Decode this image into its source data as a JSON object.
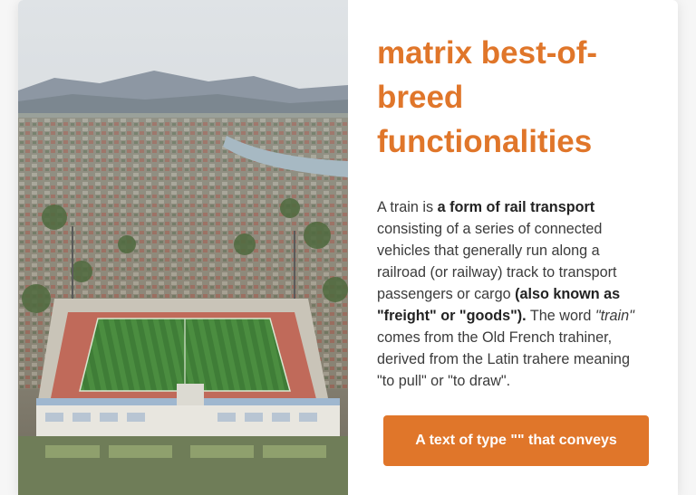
{
  "hero": {
    "image_alt": "aerial view of a stadium in a city"
  },
  "headline": "matrix best-of-breed functionalities",
  "body": {
    "part1": "A train is ",
    "bold1": "a form of rail transport",
    "part2": " consisting of a series of connected vehicles that generally run along a railroad (or railway) track to transport passengers or cargo ",
    "bold2": "(also known as \"freight\" or \"goods\").",
    "part3": " The word ",
    "italic1": "\"train\"",
    "part4": " comes from the Old French trahiner, derived from the Latin trahere meaning \"to pull\" or \"to draw\"."
  },
  "cta": {
    "label": "A text of type \"\" that conveys"
  },
  "colors": {
    "accent": "#e0762a",
    "text": "#3b3b3b"
  }
}
